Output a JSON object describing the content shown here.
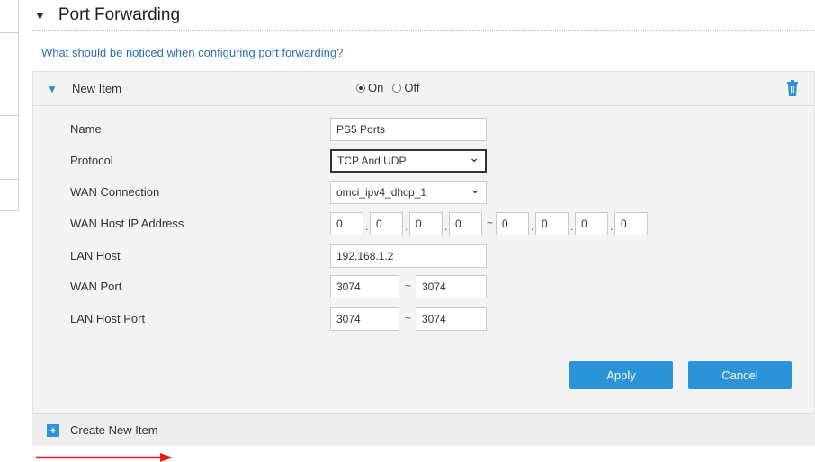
{
  "section": {
    "title": "Port Forwarding",
    "caret": "▼"
  },
  "help_link": "What should be noticed when configuring port forwarding?",
  "item": {
    "title": "New Item",
    "status_options": [
      "On",
      "Off"
    ],
    "status_selected": "On"
  },
  "form": {
    "name": {
      "label": "Name",
      "value": "PS5 Ports"
    },
    "protocol": {
      "label": "Protocol",
      "value": "TCP And UDP"
    },
    "wan_connection": {
      "label": "WAN Connection",
      "value": "omci_ipv4_dhcp_1"
    },
    "wan_host_ip": {
      "label": "WAN Host IP Address",
      "start": [
        "0",
        "0",
        "0",
        "0"
      ],
      "end": [
        "0",
        "0",
        "0",
        "0"
      ],
      "range_sep": "~",
      "octet_sep": "."
    },
    "lan_host": {
      "label": "LAN Host",
      "value": "192.168.1.2"
    },
    "wan_port": {
      "label": "WAN Port",
      "start": "3074",
      "end": "3074",
      "sep": "~"
    },
    "lan_host_port": {
      "label": "LAN Host Port",
      "start": "3074",
      "end": "3074",
      "sep": "~"
    }
  },
  "buttons": {
    "apply": "Apply",
    "cancel": "Cancel"
  },
  "create_new": {
    "label": "Create New Item",
    "icon": "plus-icon"
  },
  "icons": {
    "section_caret": "triangle-down-icon",
    "item_expand": "triangle-down-icon",
    "delete": "trash-icon",
    "annotation": "red-arrow-icon"
  },
  "colors": {
    "link": "#2a6fb8",
    "accent": "#2b93d8",
    "panel_bg": "#f3f3f3",
    "annotation_arrow": "#e0201b"
  }
}
